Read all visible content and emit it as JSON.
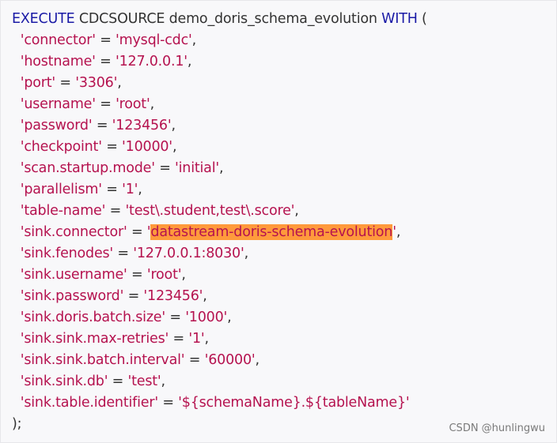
{
  "header": {
    "kw_execute": "EXECUTE",
    "kw_cdcsource": "CDCSOURCE",
    "job_name": "demo_doris_schema_evolution",
    "kw_with": "WITH",
    "open_paren": "("
  },
  "options": [
    {
      "key": "'connector'",
      "value": "'mysql-cdc'",
      "trail": ","
    },
    {
      "key": "'hostname'",
      "value": "'127.0.0.1'",
      "trail": ","
    },
    {
      "key": "'port'",
      "value": "'3306'",
      "trail": ","
    },
    {
      "key": "'username'",
      "value": "'root'",
      "trail": ","
    },
    {
      "key": "'password'",
      "value": "'123456'",
      "trail": ","
    },
    {
      "key": "'checkpoint'",
      "value": "'10000'",
      "trail": ","
    },
    {
      "key": "'scan.startup.mode'",
      "value": "'initial'",
      "trail": ","
    },
    {
      "key": "'parallelism'",
      "value": "'1'",
      "trail": ","
    },
    {
      "key": "'table-name'",
      "value": "'test\\.student,test\\.score'",
      "trail": ","
    },
    {
      "key": "'sink.connector'",
      "value_open": "'",
      "value_highlight": "datastream-doris-schema-evolution",
      "value_close": "'",
      "trail": ","
    },
    {
      "key": "'sink.fenodes'",
      "value": "'127.0.0.1:8030'",
      "trail": ","
    },
    {
      "key": "'sink.username'",
      "value": "'root'",
      "trail": ","
    },
    {
      "key": "'sink.password'",
      "value": "'123456'",
      "trail": ","
    },
    {
      "key": "'sink.doris.batch.size'",
      "value": "'1000'",
      "trail": ","
    },
    {
      "key": "'sink.sink.max-retries'",
      "value": "'1'",
      "trail": ","
    },
    {
      "key": "'sink.sink.batch.interval'",
      "value": "'60000'",
      "trail": ","
    },
    {
      "key": "'sink.sink.db'",
      "value": "'test'",
      "trail": ","
    },
    {
      "key": "'sink.table.identifier'",
      "value": "'${schemaName}.${tableName}'",
      "trail": ""
    }
  ],
  "footer": {
    "close": ");"
  },
  "watermark": "CSDN @hunlingwu",
  "colors": {
    "keyword": "#1a1aa6",
    "string": "#b5124f",
    "highlight": "#ff9a3c",
    "text": "#333333"
  }
}
